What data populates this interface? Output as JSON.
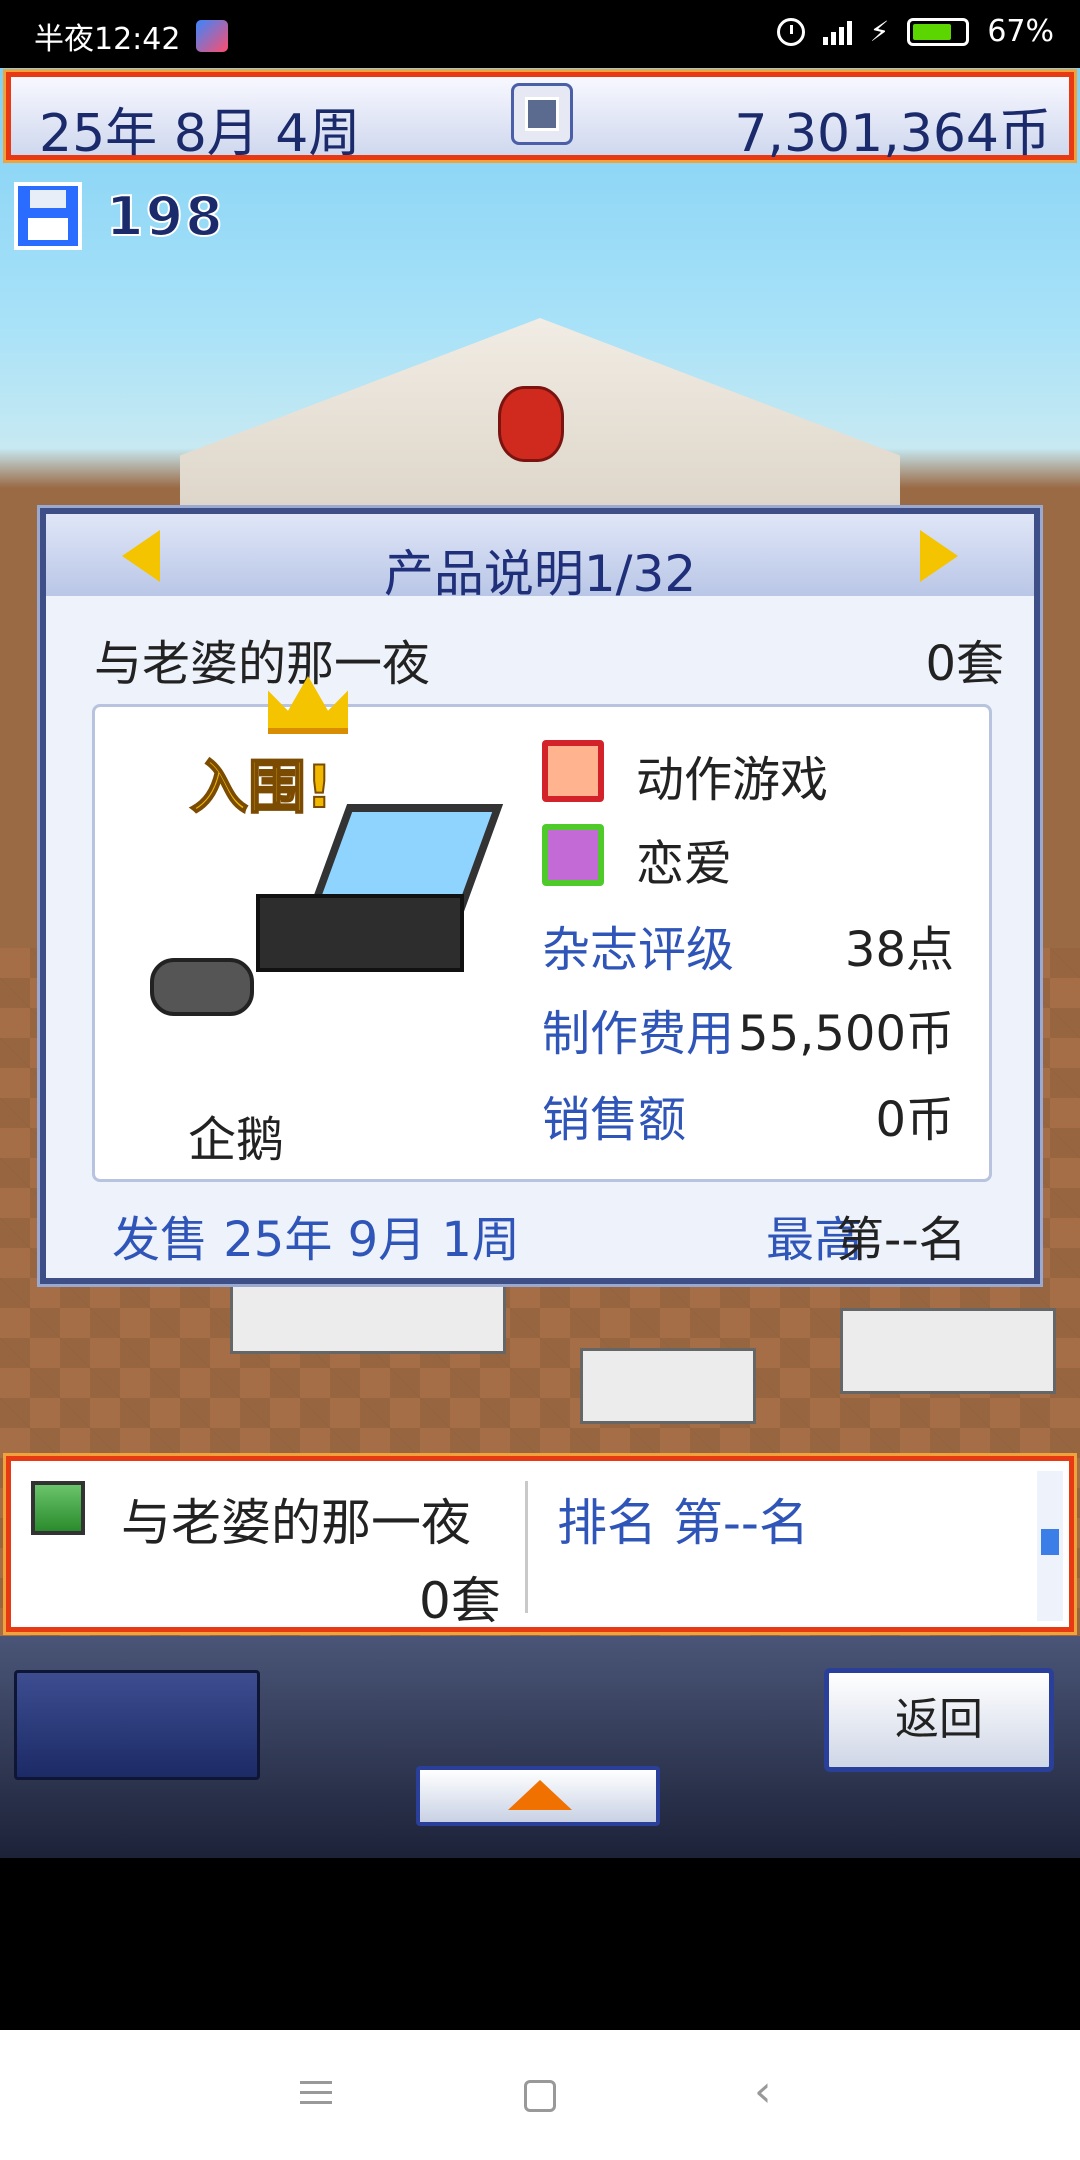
{
  "status_bar": {
    "time": "半夜12:42",
    "battery": "67%",
    "icons": [
      "app-icon",
      "alarm-icon",
      "signal-icon",
      "charging-icon",
      "battery-icon"
    ]
  },
  "top_bar": {
    "date": "25年 8月 4周",
    "money": "7,301,364币"
  },
  "save": {
    "count": "198"
  },
  "product_panel": {
    "title": "产品说明1/32",
    "name": "与老婆的那一夜",
    "count": "0套",
    "award": "入围!",
    "platform": "企鹅",
    "genres": [
      "动作游戏",
      "恋爱"
    ],
    "stats": [
      {
        "label": "杂志评级",
        "value": "38点"
      },
      {
        "label": "制作费用",
        "value": "55,500币"
      },
      {
        "label": "销售额",
        "value": "0币"
      }
    ],
    "release": "发售 25年 9月 1周",
    "best_label": "最高",
    "best_value": "第--名"
  },
  "list": {
    "name": "与老婆的那一夜",
    "count": "0套",
    "rank": "排名 第--名"
  },
  "toolbar": {
    "back_label": "返回"
  },
  "colors": {
    "frame_red": "#e83a12",
    "title_blue": "#1f2f7a",
    "label_blue": "#2f55b8",
    "panel_bg": "#eef2fb"
  }
}
